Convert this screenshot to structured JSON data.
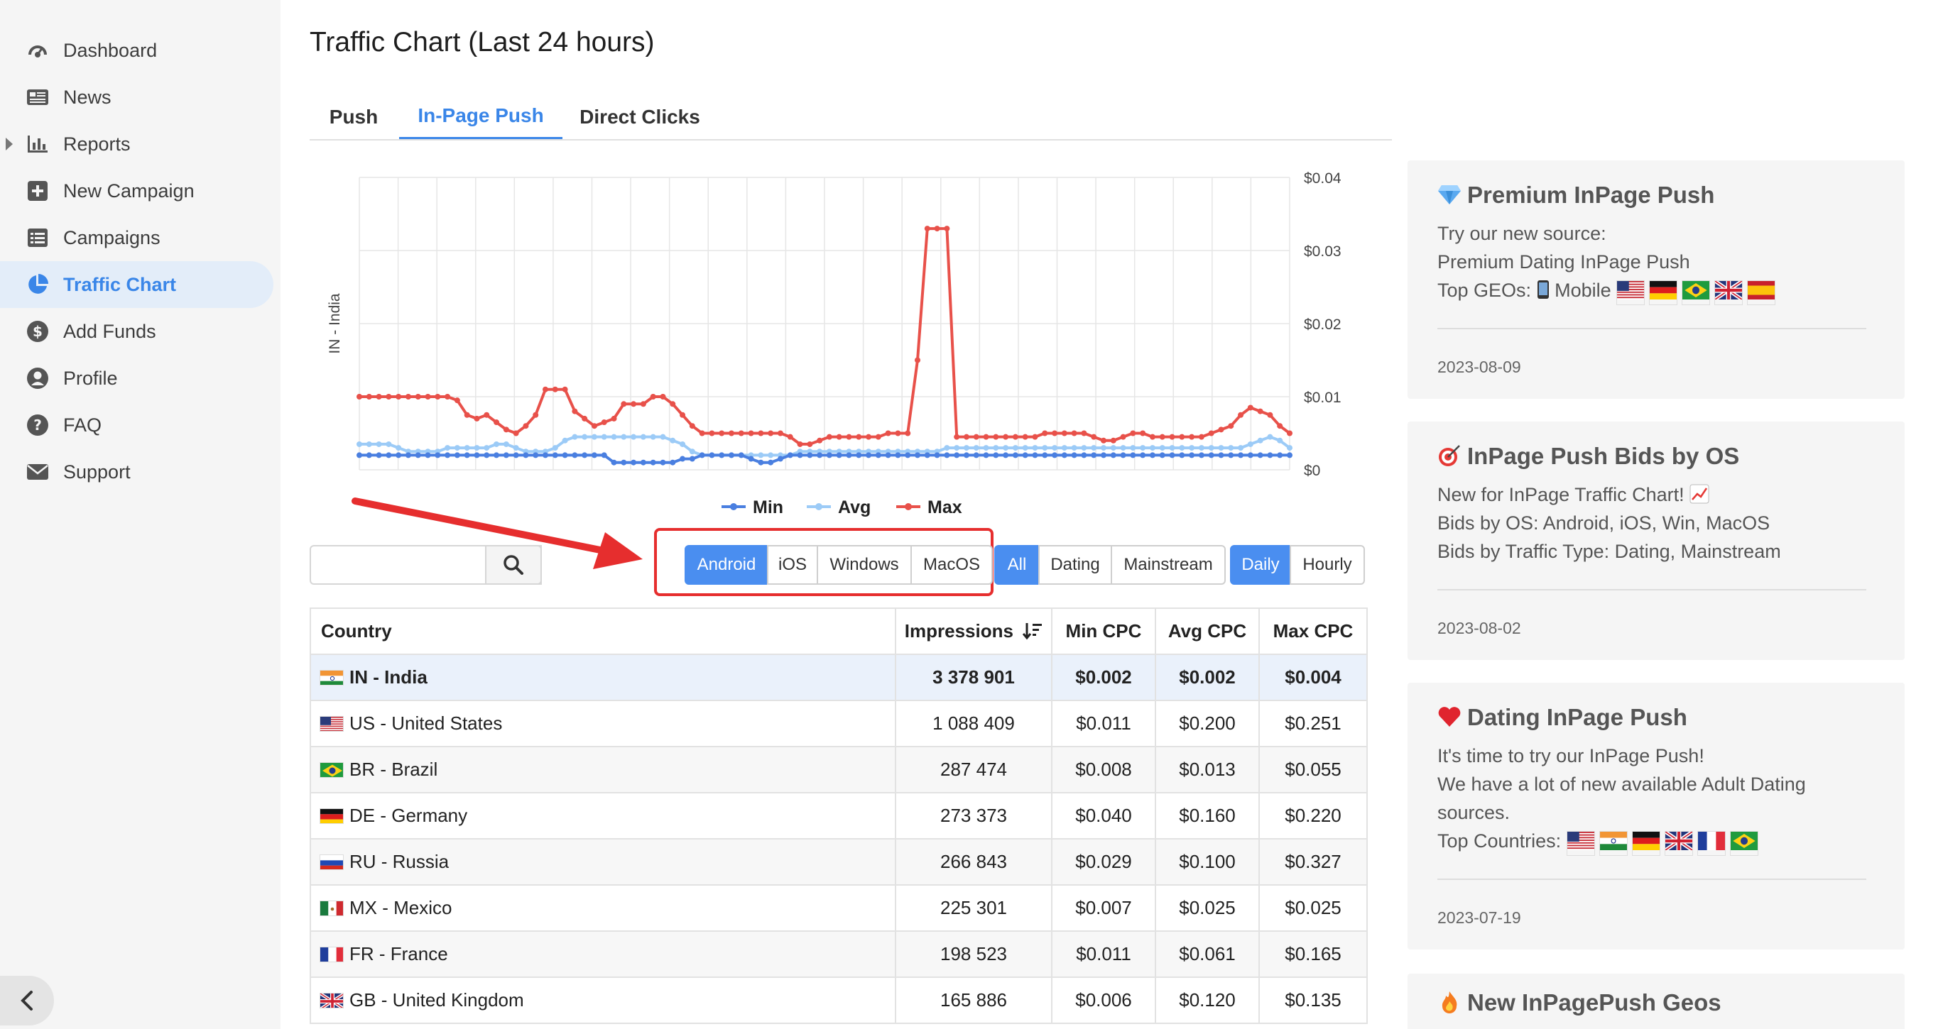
{
  "sidebar": {
    "items": [
      {
        "label": "Dashboard",
        "icon": "speedometer-icon"
      },
      {
        "label": "News",
        "icon": "newspaper-icon"
      },
      {
        "label": "Reports",
        "icon": "bar-chart-icon"
      },
      {
        "label": "New Campaign",
        "icon": "plus-square-icon"
      },
      {
        "label": "Campaigns",
        "icon": "list-icon"
      },
      {
        "label": "Traffic Chart",
        "icon": "pie-chart-icon",
        "active": true
      },
      {
        "label": "Add Funds",
        "icon": "dollar-circle-icon"
      },
      {
        "label": "Profile",
        "icon": "user-circle-icon"
      },
      {
        "label": "FAQ",
        "icon": "question-circle-icon"
      },
      {
        "label": "Support",
        "icon": "envelope-icon"
      }
    ]
  },
  "header": {
    "title": "Traffic Chart (Last 24 hours)"
  },
  "tabs": [
    {
      "label": "Push"
    },
    {
      "label": "In-Page Push",
      "active": true
    },
    {
      "label": "Direct Clicks"
    }
  ],
  "filters": {
    "search_placeholder": "",
    "os": [
      {
        "label": "Android",
        "active": true
      },
      {
        "label": "iOS"
      },
      {
        "label": "Windows"
      },
      {
        "label": "MacOS"
      }
    ],
    "traffic_type": [
      {
        "label": "All",
        "active": true
      },
      {
        "label": "Dating"
      },
      {
        "label": "Mainstream"
      }
    ],
    "period": [
      {
        "label": "Daily",
        "active": true
      },
      {
        "label": "Hourly"
      }
    ]
  },
  "chart_data": {
    "type": "line",
    "ylabel": "IN - India",
    "y_tick_labels": [
      "$0",
      "$0.01",
      "$0.02",
      "$0.03",
      "$0.04"
    ],
    "ylim": [
      0,
      0.04
    ],
    "y_axis_side": "right",
    "grid": true,
    "legend_position": "bottom",
    "series": [
      {
        "name": "Min",
        "color": "#4a7fe0",
        "values": [
          0.002,
          0.002,
          0.002,
          0.002,
          0.002,
          0.002,
          0.002,
          0.002,
          0.002,
          0.002,
          0.002,
          0.002,
          0.002,
          0.002,
          0.002,
          0.002,
          0.002,
          0.002,
          0.002,
          0.002,
          0.002,
          0.002,
          0.002,
          0.002,
          0.002,
          0.002,
          0.001,
          0.001,
          0.001,
          0.001,
          0.001,
          0.001,
          0.001,
          0.0015,
          0.0015,
          0.002,
          0.002,
          0.002,
          0.002,
          0.002,
          0.0015,
          0.001,
          0.001,
          0.0015,
          0.002,
          0.002,
          0.002,
          0.002,
          0.002,
          0.002,
          0.002,
          0.002,
          0.002,
          0.002,
          0.002,
          0.002,
          0.002,
          0.002,
          0.002,
          0.002,
          0.002,
          0.002,
          0.002,
          0.002,
          0.002,
          0.002,
          0.002,
          0.002,
          0.002,
          0.002,
          0.002,
          0.002,
          0.002,
          0.002,
          0.002,
          0.002,
          0.002,
          0.002,
          0.002,
          0.002,
          0.002,
          0.002,
          0.002,
          0.002,
          0.002,
          0.002,
          0.002,
          0.002,
          0.002,
          0.002,
          0.002,
          0.002,
          0.002,
          0.002,
          0.002,
          0.002
        ]
      },
      {
        "name": "Avg",
        "color": "#9ccbf7",
        "values": [
          0.0035,
          0.0035,
          0.0035,
          0.0035,
          0.003,
          0.0025,
          0.0025,
          0.0025,
          0.0025,
          0.003,
          0.003,
          0.003,
          0.003,
          0.003,
          0.0035,
          0.0035,
          0.003,
          0.0025,
          0.0025,
          0.0025,
          0.003,
          0.004,
          0.0045,
          0.0045,
          0.0045,
          0.0045,
          0.0045,
          0.0045,
          0.0045,
          0.0045,
          0.0045,
          0.0045,
          0.004,
          0.0035,
          0.0025,
          0.002,
          0.002,
          0.002,
          0.002,
          0.002,
          0.002,
          0.002,
          0.002,
          0.002,
          0.002,
          0.0025,
          0.0025,
          0.0025,
          0.0025,
          0.0025,
          0.0025,
          0.0025,
          0.0025,
          0.0025,
          0.0025,
          0.0025,
          0.0025,
          0.0025,
          0.0025,
          0.0025,
          0.003,
          0.003,
          0.003,
          0.003,
          0.003,
          0.003,
          0.003,
          0.003,
          0.003,
          0.003,
          0.003,
          0.003,
          0.003,
          0.003,
          0.003,
          0.003,
          0.003,
          0.003,
          0.003,
          0.003,
          0.003,
          0.003,
          0.003,
          0.003,
          0.003,
          0.003,
          0.003,
          0.003,
          0.003,
          0.003,
          0.003,
          0.0035,
          0.004,
          0.0045,
          0.004,
          0.003
        ]
      },
      {
        "name": "Max",
        "color": "#e8514a",
        "values": [
          0.01,
          0.01,
          0.01,
          0.01,
          0.01,
          0.01,
          0.01,
          0.01,
          0.01,
          0.01,
          0.0095,
          0.0075,
          0.007,
          0.0075,
          0.0065,
          0.0055,
          0.005,
          0.006,
          0.0075,
          0.011,
          0.011,
          0.011,
          0.008,
          0.007,
          0.006,
          0.0065,
          0.007,
          0.009,
          0.009,
          0.009,
          0.01,
          0.01,
          0.009,
          0.0075,
          0.006,
          0.005,
          0.005,
          0.005,
          0.005,
          0.005,
          0.005,
          0.005,
          0.005,
          0.005,
          0.0045,
          0.0035,
          0.0035,
          0.004,
          0.0045,
          0.0045,
          0.0045,
          0.0045,
          0.0045,
          0.0045,
          0.005,
          0.005,
          0.005,
          0.015,
          0.033,
          0.033,
          0.033,
          0.0045,
          0.0045,
          0.0045,
          0.0045,
          0.0045,
          0.0045,
          0.0045,
          0.0045,
          0.0045,
          0.005,
          0.005,
          0.005,
          0.005,
          0.005,
          0.0045,
          0.004,
          0.004,
          0.0045,
          0.005,
          0.005,
          0.0045,
          0.0045,
          0.0045,
          0.0045,
          0.0045,
          0.0045,
          0.005,
          0.0055,
          0.006,
          0.0075,
          0.0085,
          0.008,
          0.0075,
          0.006,
          0.005
        ]
      }
    ]
  },
  "table": {
    "columns": [
      "Country",
      "Impressions",
      "Min CPC",
      "Avg CPC",
      "Max CPC"
    ],
    "rows": [
      {
        "flag": "IN",
        "country": "IN - India",
        "impressions": "3 378 901",
        "min": "$0.002",
        "avg": "$0.002",
        "max": "$0.004",
        "highlight": true
      },
      {
        "flag": "US",
        "country": "US - United States",
        "impressions": "1 088 409",
        "min": "$0.011",
        "avg": "$0.200",
        "max": "$0.251"
      },
      {
        "flag": "BR",
        "country": "BR - Brazil",
        "impressions": "287 474",
        "min": "$0.008",
        "avg": "$0.013",
        "max": "$0.055"
      },
      {
        "flag": "DE",
        "country": "DE - Germany",
        "impressions": "273 373",
        "min": "$0.040",
        "avg": "$0.160",
        "max": "$0.220"
      },
      {
        "flag": "RU",
        "country": "RU - Russia",
        "impressions": "266 843",
        "min": "$0.029",
        "avg": "$0.100",
        "max": "$0.327"
      },
      {
        "flag": "MX",
        "country": "MX - Mexico",
        "impressions": "225 301",
        "min": "$0.007",
        "avg": "$0.025",
        "max": "$0.025"
      },
      {
        "flag": "FR",
        "country": "FR - France",
        "impressions": "198 523",
        "min": "$0.011",
        "avg": "$0.061",
        "max": "$0.165"
      },
      {
        "flag": "GB",
        "country": "GB - United Kingdom",
        "impressions": "165 886",
        "min": "$0.006",
        "avg": "$0.120",
        "max": "$0.135"
      }
    ]
  },
  "news": [
    {
      "icon": "diamond-icon",
      "title": "Premium InPage Push",
      "lines": [
        "Try our new source:",
        "Premium Dating InPage Push",
        "Top GEOs: "
      ],
      "mobile_label": "Mobile",
      "flags": [
        "US",
        "DE",
        "BR",
        "GB",
        "ES"
      ],
      "date": "2023-08-09"
    },
    {
      "icon": "target-icon",
      "title": "InPage Push Bids by OS",
      "lines": [
        "New for InPage Traffic Chart!",
        "Bids by OS: Android, iOS, Win, MacOS",
        "Bids by Traffic Type: Dating, Mainstream"
      ],
      "date": "2023-08-02"
    },
    {
      "icon": "heart-icon",
      "title": "Dating InPage Push",
      "lines": [
        "It's time to try our InPage Push!",
        "We have a lot of new available Adult Dating",
        "sources.",
        "Top Countries: "
      ],
      "flags": [
        "US",
        "IN",
        "DE",
        "GB",
        "FR",
        "BR"
      ],
      "date": "2023-07-19"
    },
    {
      "icon": "fire-icon",
      "title": "New InPagePush Geos"
    }
  ],
  "colors": {
    "accent": "#3a86e8",
    "button_active": "#4a8ef0",
    "highlight_row": "#eaf1fb",
    "annotation": "#e62e2e"
  }
}
